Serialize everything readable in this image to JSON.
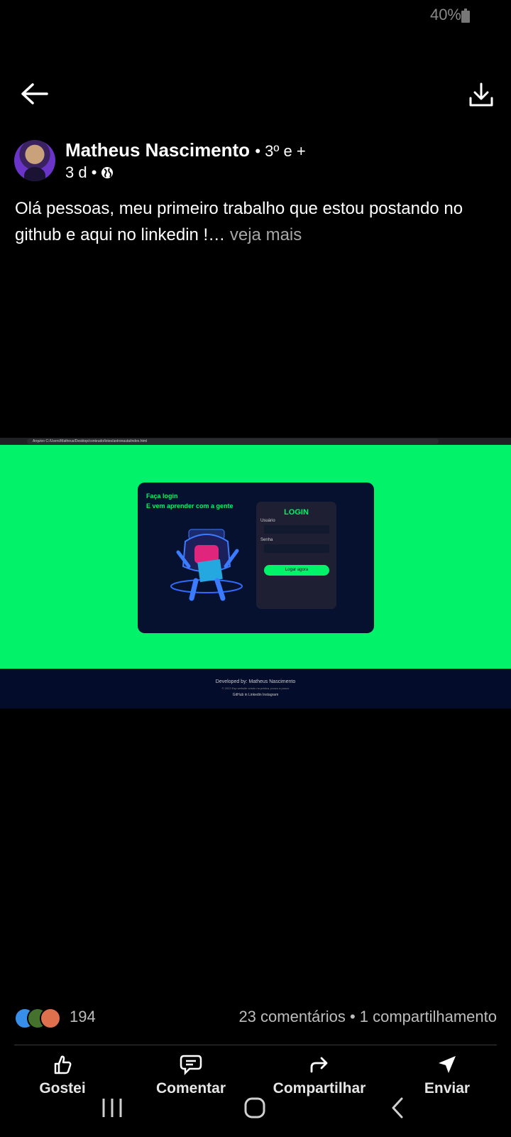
{
  "status_bar": {
    "battery": "40%"
  },
  "header": {
    "back_icon": "arrow-left-icon",
    "download_icon": "download-icon"
  },
  "post": {
    "author": "Matheus Nascimento",
    "connection": "• 3º e +",
    "age": "3 d •",
    "visibility_icon": "globe-icon",
    "text": "Olá pessoas, meu primeiro trabalho que estou postando no github e aqui no linkedin !…",
    "see_more": "veja mais"
  },
  "image": {
    "browser_address": "Arquivo  C:/Users/Matheus/Desktop/conteudo/lotes/astronauta/index.html",
    "card": {
      "title_line1": "Faça login",
      "title_line2": "E vem aprender com a gente",
      "login_title": "LOGIN",
      "username_label": "Usuário",
      "password_label": "Senha",
      "button": "Logar agora"
    },
    "footer": {
      "developed_by": "Developed by: Matheus Nascimento",
      "copyright": "© 2022 Esp website criado na prática, pouco a pouco",
      "links": "GitHub   in Linkedin   Instagram"
    },
    "colors": {
      "background": "#02f36a",
      "card": "#061130",
      "footer": "#030d2b"
    }
  },
  "engagement": {
    "reaction_count": "194",
    "comments_shares": "23 comentários • 1 compartilhamento"
  },
  "actions": {
    "like": "Gostei",
    "comment": "Comentar",
    "share": "Compartilhar",
    "send": "Enviar"
  }
}
